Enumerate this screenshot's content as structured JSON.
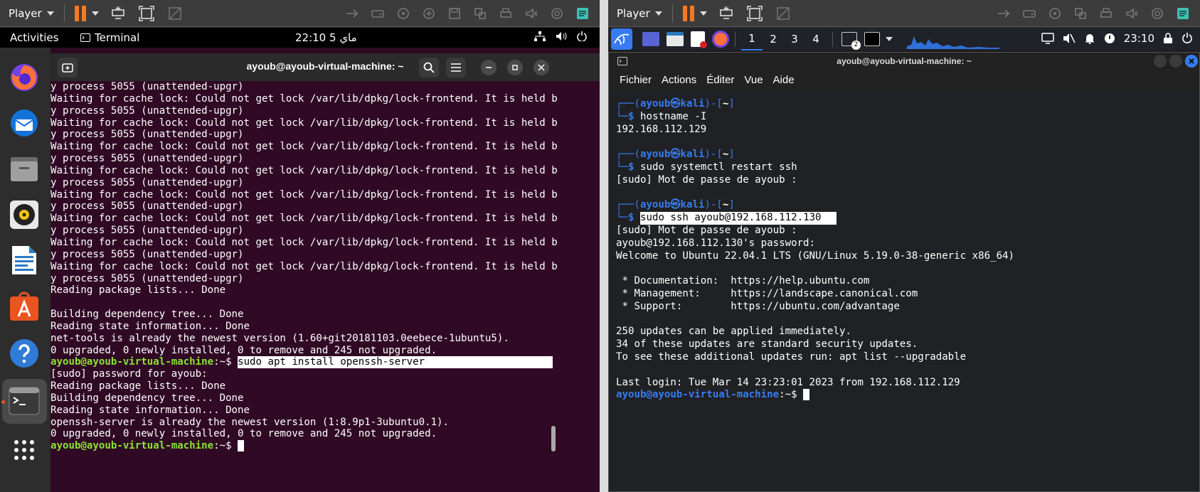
{
  "left_vm": {
    "player_label": "Player",
    "topbar": {
      "activities": "Activities",
      "app": "Terminal",
      "clock": "22:10  5 ماي"
    },
    "window_title": "ayoub@ayoub-virtual-machine: ~",
    "prompt_user": "ayoub@ayoub-virtual-machine",
    "prompt_path": ":~$",
    "lines": [
      "y process 5055 (unattended-upgr)",
      "Waiting for cache lock: Could not get lock /var/lib/dpkg/lock-frontend. It is held b",
      "y process 5055 (unattended-upgr)",
      "Waiting for cache lock: Could not get lock /var/lib/dpkg/lock-frontend. It is held b",
      "y process 5055 (unattended-upgr)",
      "Waiting for cache lock: Could not get lock /var/lib/dpkg/lock-frontend. It is held b",
      "y process 5055 (unattended-upgr)",
      "Waiting for cache lock: Could not get lock /var/lib/dpkg/lock-frontend. It is held b",
      "y process 5055 (unattended-upgr)",
      "Waiting for cache lock: Could not get lock /var/lib/dpkg/lock-frontend. It is held b",
      "y process 5055 (unattended-upgr)",
      "Waiting for cache lock: Could not get lock /var/lib/dpkg/lock-frontend. It is held b",
      "y process 5055 (unattended-upgr)",
      "Waiting for cache lock: Could not get lock /var/lib/dpkg/lock-frontend. It is held b",
      "y process 5055 (unattended-upgr)",
      "Waiting for cache lock: Could not get lock /var/lib/dpkg/lock-frontend. It is held b",
      "y process 5055 (unattended-upgr)",
      "Reading package lists... Done",
      "",
      "Building dependency tree... Done",
      "Reading state information... Done",
      "net-tools is already the newest version (1.60+git20181103.0eebece-1ubuntu5).",
      "0 upgraded, 0 newly installed, 0 to remove and 245 not upgraded."
    ],
    "command": "sudo apt install openssh-server",
    "after_lines": [
      "[sudo] password for ayoub:",
      "Reading package lists... Done",
      "Building dependency tree... Done",
      "Reading state information... Done",
      "openssh-server is already the newest version (1:8.9p1-3ubuntu0.1).",
      "0 upgraded, 0 newly installed, 0 to remove and 245 not upgraded."
    ]
  },
  "right_vm": {
    "player_label": "Player",
    "workspaces": [
      "1",
      "2",
      "3",
      "4"
    ],
    "clock": "23:10",
    "badge": "2",
    "window_title": "ayoub@ayoub-virtual-machine: ~",
    "menu": [
      "Fichier",
      "Actions",
      "Éditer",
      "Vue",
      "Aide"
    ],
    "kali_prompt_user": "ayoub",
    "kali_prompt_host": "kali",
    "kali_prompt_dir": "~",
    "blocks": [
      {
        "cmd": "hostname -I",
        "output": [
          "192.168.112.129"
        ]
      },
      {
        "cmd": "sudo systemctl restart ssh",
        "output": [
          "[sudo] Mot de passe de ayoub :"
        ]
      }
    ],
    "ssh_cmd": "sudo ssh ayoub@192.168.112.130",
    "ssh_output": [
      "[sudo] Mot de passe de ayoub :",
      "ayoub@192.168.112.130's password:",
      "Welcome to Ubuntu 22.04.1 LTS (GNU/Linux 5.19.0-38-generic x86_64)",
      "",
      " * Documentation:  https://help.ubuntu.com",
      " * Management:     https://landscape.canonical.com",
      " * Support:        https://ubuntu.com/advantage",
      "",
      "250 updates can be applied immediately.",
      "34 of these updates are standard security updates.",
      "To see these additional updates run: apt list --upgradable",
      "",
      "Last login: Tue Mar 14 23:23:01 2023 from 192.168.112.129"
    ],
    "remote_prompt_user": "ayoub@ayoub-virtual-machine",
    "remote_prompt_path": ":~$"
  },
  "colors": {
    "ubuntu_terminal_bg": "#300a24",
    "ubuntu_prompt": "#8ae234",
    "kali_accent": "#367bf0",
    "vmware_pause": "#f47a20"
  },
  "icons": [
    "pause-icon",
    "send-ctrl-alt-del-icon",
    "fit-guest-icon",
    "unity-icon",
    "dock-firefox-icon",
    "dock-thunderbird-icon",
    "dock-files-icon",
    "dock-rhythmbox-icon",
    "dock-writer-icon",
    "dock-software-icon",
    "dock-help-icon",
    "dock-terminal-icon",
    "dock-apps-grid-icon",
    "network-icon",
    "volume-icon",
    "power-icon",
    "kali-menu-icon",
    "bell-icon",
    "lock-icon"
  ]
}
